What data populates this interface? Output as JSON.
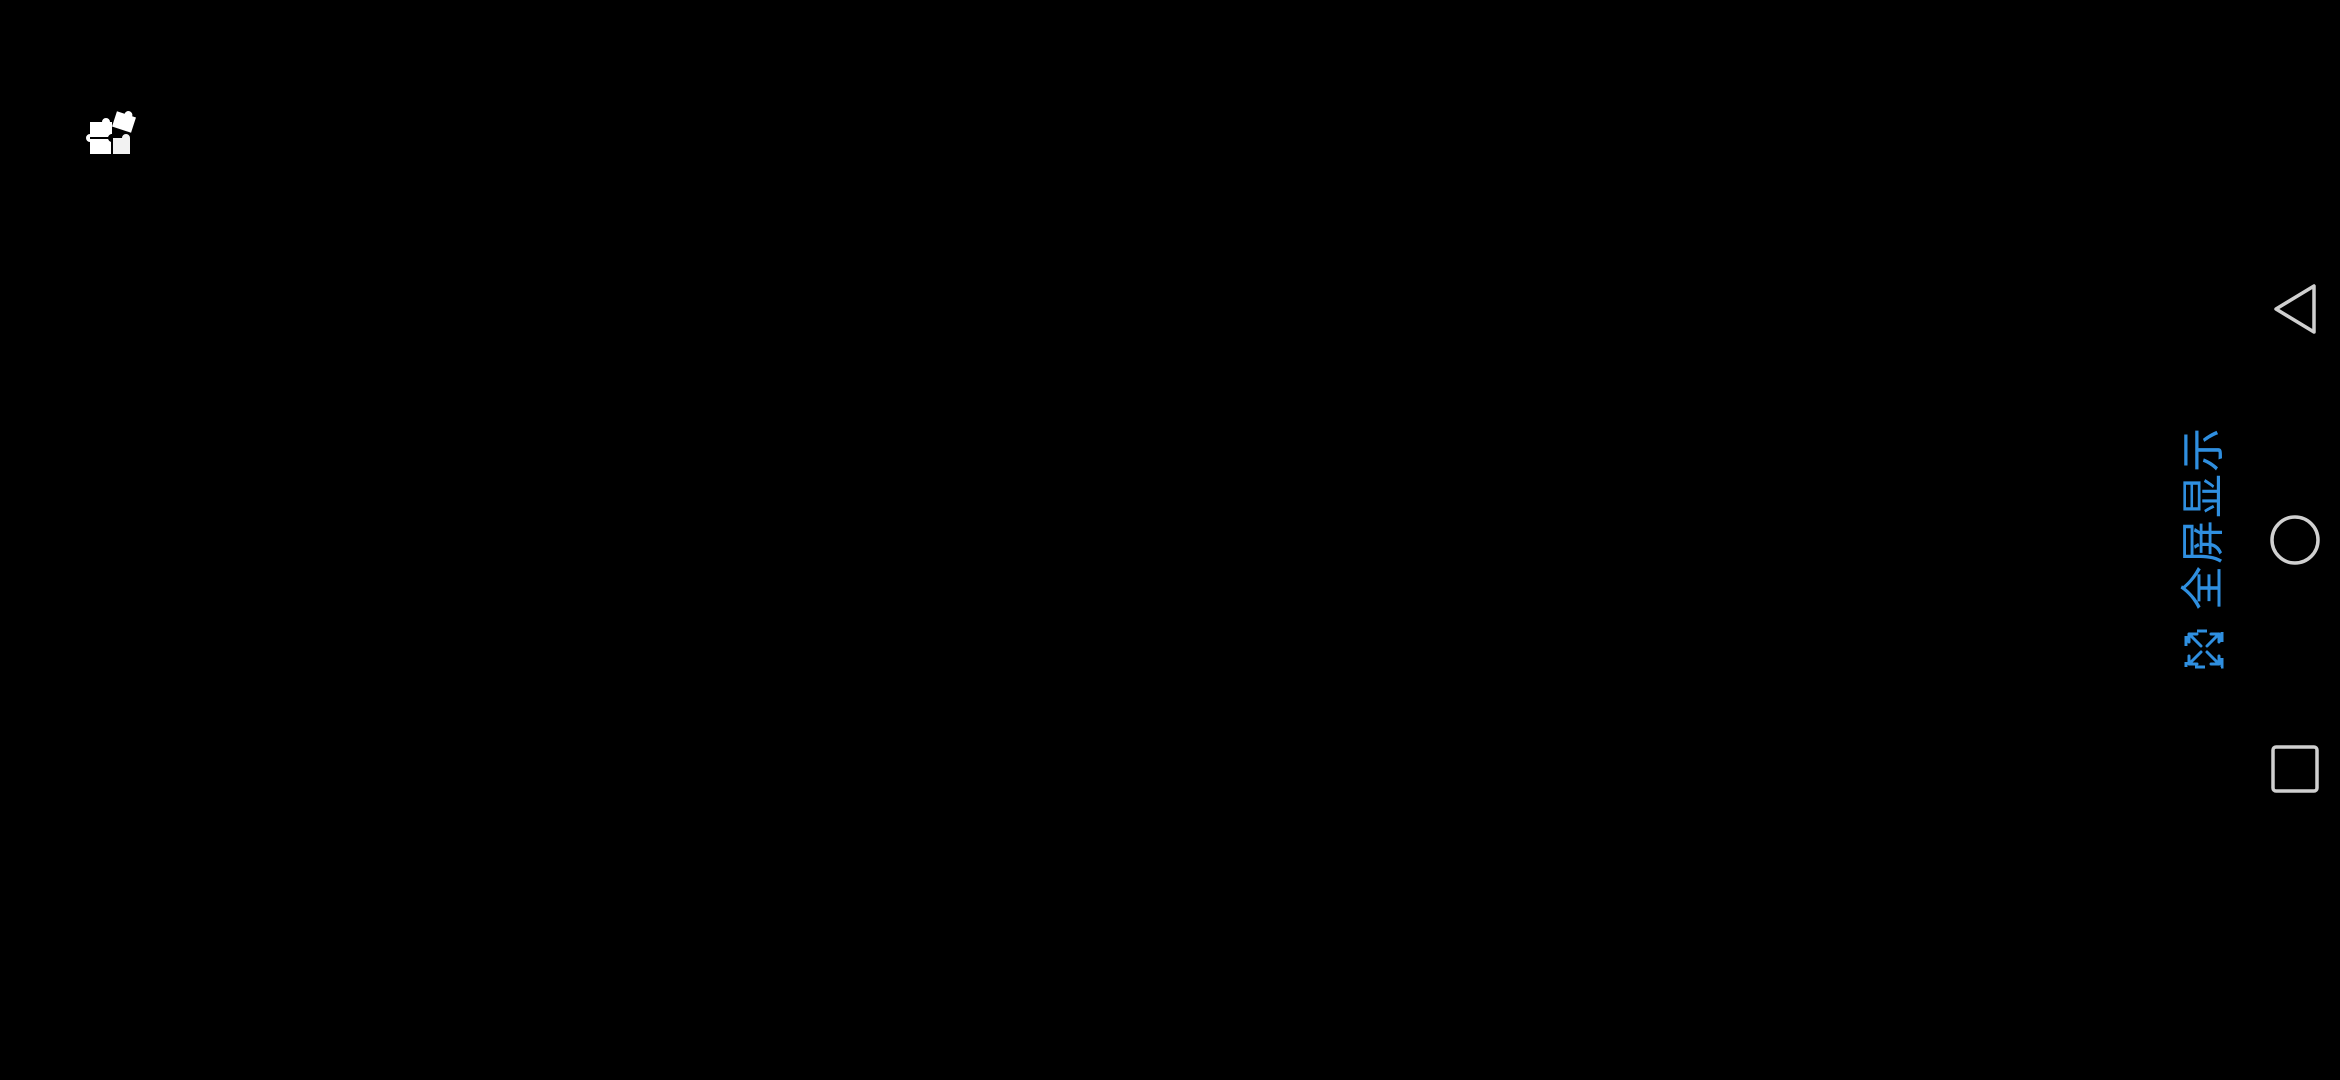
{
  "app": {
    "icon": "puzzle-pieces-icon"
  },
  "fullscreen": {
    "label": "全屏显示",
    "icon": "expand-arrows-icon",
    "color": "#2f8fe0"
  },
  "navigation_bar": {
    "back_icon": "triangle-back-icon",
    "home_icon": "circle-home-icon",
    "recents_icon": "square-recents-icon",
    "color": "#d0d0d0"
  }
}
